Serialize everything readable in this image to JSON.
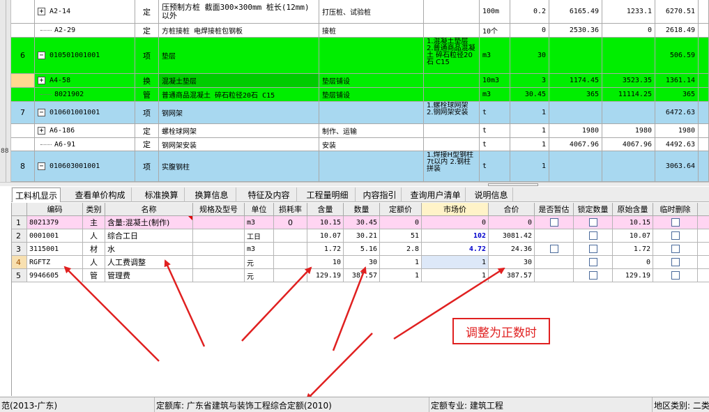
{
  "upper_rows": [
    {
      "index": "",
      "expander": "+",
      "code": "A2-14",
      "type": "定",
      "name": "压预制方桩 截面300×300mm 桩长(12mm)以外",
      "work": "打压桩、试验桩",
      "feature": "",
      "unit": "100m",
      "qty": "0.2",
      "price1": "6165.49",
      "price2": "1233.1",
      "total": "6270.51"
    },
    {
      "index": "",
      "expander": "",
      "code": "A2-29",
      "type": "定",
      "name": "方桩接桩 电焊接桩包钢板",
      "work": "接桩",
      "feature": "",
      "unit": "10个",
      "qty": "0",
      "price1": "2530.36",
      "price2": "0",
      "total": "2618.49"
    },
    {
      "index": "6",
      "expander": "−",
      "code": "010501001001",
      "type": "项",
      "name": "垫层",
      "work": "",
      "feature": "1.混凝土垫层\n2.普通商品混凝土 碎石粒径20石 C15",
      "unit": "m3",
      "qty": "30",
      "price1": "",
      "price2": "",
      "total": "506.59"
    },
    {
      "index": "",
      "expander": "+",
      "code": "A4-58",
      "type": "换",
      "name": "混凝土垫层",
      "work": "垫层铺设",
      "feature": "",
      "unit": "10m3",
      "qty": "3",
      "price1": "1174.45",
      "price2": "3523.35",
      "total": "1361.14"
    },
    {
      "index": "",
      "expander": "",
      "code": "8021902",
      "type": "管",
      "name": "普通商品混凝土 碎石粒径20石 C15",
      "work": "垫层铺设",
      "feature": "",
      "unit": "m3",
      "qty": "30.45",
      "price1": "365",
      "price2": "11114.25",
      "total": "365"
    },
    {
      "index": "7",
      "expander": "−",
      "code": "010601001001",
      "type": "项",
      "name": "钢网架",
      "work": "",
      "feature": "1.螺栓球网架\n2.钢网架安装",
      "unit": "t",
      "qty": "1",
      "price1": "",
      "price2": "",
      "total": "6472.63"
    },
    {
      "index": "",
      "expander": "+",
      "code": "A6-186",
      "type": "定",
      "name": "螺栓球网架",
      "work": "制作、运输",
      "feature": "",
      "unit": "t",
      "qty": "1",
      "price1": "1980",
      "price2": "1980",
      "total": "1980"
    },
    {
      "index": "",
      "expander": "",
      "code": "A6-91",
      "type": "定",
      "name": "钢网架安装",
      "work": "安装",
      "feature": "",
      "unit": "t",
      "qty": "1",
      "price1": "4067.96",
      "price2": "4067.96",
      "total": "4492.63"
    },
    {
      "index": "8",
      "expander": "−",
      "code": "010603001001",
      "type": "项",
      "name": "实腹钢柱",
      "work": "",
      "feature": "1.焊接H型钢柱 7t以内\n2.钢柱拼装",
      "unit": "t",
      "qty": "1",
      "price1": "",
      "price2": "",
      "total": "3063.64"
    }
  ],
  "tabs": [
    "工料机显示",
    "查看单价构成",
    "标准换算",
    "换算信息",
    "特征及内容",
    "工程量明细",
    "内容指引",
    "查询用户清单",
    "说明信息"
  ],
  "lower_headers": [
    "编码",
    "类别",
    "名称",
    "规格及型号",
    "单位",
    "损耗率",
    "含量",
    "数量",
    "定额价",
    "市场价",
    "合价",
    "是否暂估",
    "锁定数量",
    "原始含量",
    "临时删除"
  ],
  "lower_rows": [
    {
      "n": "1",
      "code": "8021379",
      "cat": "主",
      "name": "含量:混凝土(制作)",
      "spec": "",
      "unit": "m3",
      "loss": "0",
      "content": "10.15",
      "qty": "30.45",
      "quota": "0",
      "market": "0",
      "total": "0",
      "est": true,
      "lock": true,
      "orig": "10.15",
      "del": true
    },
    {
      "n": "2",
      "code": "0001001",
      "cat": "人",
      "name": "综合工日",
      "spec": "",
      "unit": "工日",
      "loss": "",
      "content": "10.07",
      "qty": "30.21",
      "quota": "51",
      "market": "102",
      "total": "3081.42",
      "est": false,
      "lock": true,
      "orig": "10.07",
      "del": true
    },
    {
      "n": "3",
      "code": "3115001",
      "cat": "材",
      "name": "水",
      "spec": "",
      "unit": "m3",
      "loss": "",
      "content": "1.72",
      "qty": "5.16",
      "quota": "2.8",
      "market": "4.72",
      "total": "24.36",
      "est": true,
      "lock": true,
      "orig": "1.72",
      "del": true
    },
    {
      "n": "4",
      "code": "RGFTZ",
      "cat": "人",
      "name": "人工费调整",
      "spec": "",
      "unit": "元",
      "loss": "",
      "content": "10",
      "qty": "30",
      "quota": "1",
      "market": "1",
      "total": "30",
      "est": false,
      "lock": true,
      "orig": "0",
      "del": true
    },
    {
      "n": "5",
      "code": "9946605",
      "cat": "管",
      "name": "管理费",
      "spec": "",
      "unit": "元",
      "loss": "",
      "content": "129.19",
      "qty": "387.57",
      "quota": "1",
      "market": "1",
      "total": "387.57",
      "est": false,
      "lock": true,
      "orig": "129.19",
      "del": true
    }
  ],
  "annotation": {
    "text": "调整为正数时",
    "color": "#e02020"
  },
  "status": {
    "left": "范(2013-广东)",
    "quota_lib": "定额库: 广东省建筑与装饰工程综合定额(2010)",
    "quota_major": "定额专业: 建筑工程",
    "region": "地区类别: 二类"
  },
  "left_glyph": "88"
}
